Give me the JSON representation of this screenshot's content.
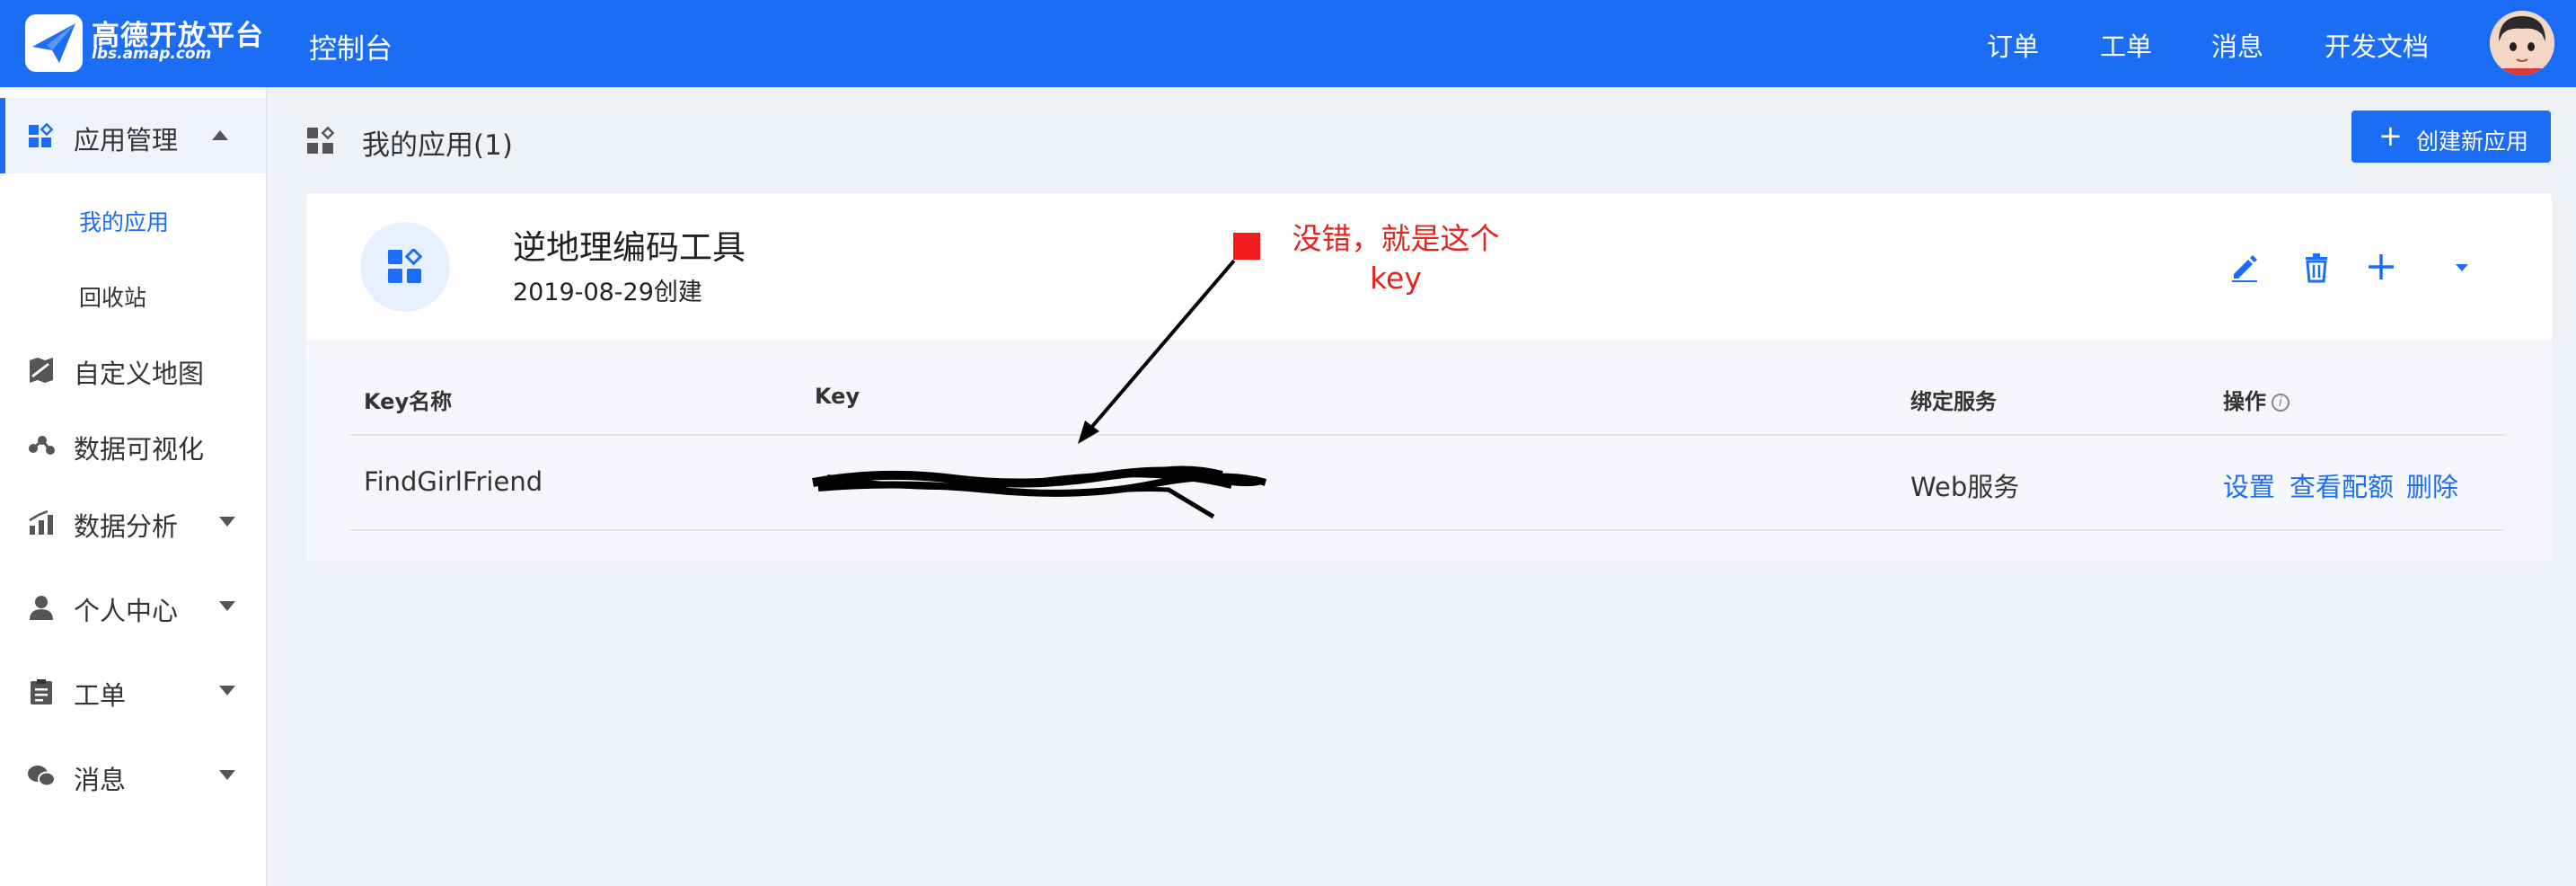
{
  "brand": {
    "title": "高德开放平台",
    "subtitle": "lbs.amap.com",
    "color": "#1b6df5"
  },
  "header": {
    "console_label": "控制台",
    "nav": [
      "订单",
      "工单",
      "消息",
      "开发文档"
    ]
  },
  "sidebar": {
    "items": [
      {
        "label": "应用管理",
        "icon": "apps-icon",
        "expanded": true
      },
      {
        "label": "自定义地图",
        "icon": "custom-map-icon"
      },
      {
        "label": "数据可视化",
        "icon": "data-vis-icon"
      },
      {
        "label": "数据分析",
        "icon": "bar-chart-icon"
      },
      {
        "label": "个人中心",
        "icon": "user-icon"
      },
      {
        "label": "工单",
        "icon": "clipboard-icon"
      },
      {
        "label": "消息",
        "icon": "chat-icon"
      }
    ],
    "sub_items": [
      {
        "label": "我的应用",
        "active": true
      },
      {
        "label": "回收站"
      }
    ]
  },
  "main": {
    "title": "我的应用(1)",
    "create_button": "创建新应用"
  },
  "app_card": {
    "name": "逆地理编码工具",
    "created": "2019-08-29创建",
    "table": {
      "headers": [
        "Key名称",
        "Key",
        "绑定服务",
        "操作"
      ],
      "rows": [
        {
          "key_name": "FindGirlFriend",
          "service": "Web服务",
          "actions": [
            "设置",
            "查看配额",
            "删除"
          ]
        }
      ]
    }
  },
  "annotation": {
    "text_line1": "没错，就是这个",
    "text_line2": "key",
    "color": "#e2251f"
  }
}
